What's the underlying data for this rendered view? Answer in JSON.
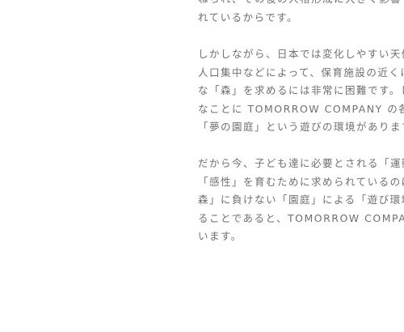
{
  "article": {
    "paragraphs": [
      {
        "lines": [
          "ねられ、その後の人格形成に大きく影響す",
          "れているからです。"
        ]
      },
      {
        "lines": [
          "しかしながら、日本では変化しやすい天候や",
          "人口集中などによって、保育施設の近くに非",
          "な「森」を求めるには非常に困難です。しか",
          "なことに TOMORROW COMPANY の各保",
          "「夢の園庭」という遊びの環境があります。"
        ]
      },
      {
        "lines": [
          "だから今、子ども達に必要とされる「運動",
          "「感性」を育むために求められているのは",
          "森」に負けない「園庭」による「遊び環境」",
          "ることであると、TOMORROW COMPANY",
          "います。"
        ]
      }
    ]
  }
}
